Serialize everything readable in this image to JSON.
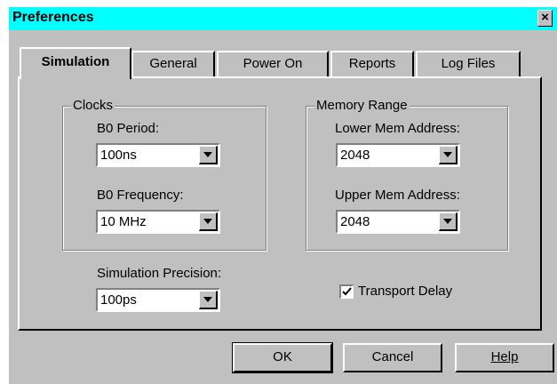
{
  "window": {
    "title": "Preferences",
    "close_label": "×"
  },
  "tabs": [
    {
      "label": "Simulation",
      "active": true
    },
    {
      "label": "General",
      "active": false
    },
    {
      "label": "Power On",
      "active": false
    },
    {
      "label": "Reports",
      "active": false
    },
    {
      "label": "Log Files",
      "active": false
    }
  ],
  "clocks": {
    "group_label": "Clocks",
    "period_label": "B0 Period:",
    "period_value": "100ns",
    "frequency_label": "B0 Frequency:",
    "frequency_value": "10 MHz"
  },
  "memory": {
    "group_label": "Memory Range",
    "lower_label": "Lower Mem Address:",
    "lower_value": "2048",
    "upper_label": "Upper Mem Address:",
    "upper_value": "2048"
  },
  "precision": {
    "label": "Simulation Precision:",
    "value": "100ps"
  },
  "transport_delay": {
    "label": "Transport Delay",
    "checked": true
  },
  "buttons": {
    "ok": "OK",
    "cancel": "Cancel",
    "help": "Help"
  },
  "colors": {
    "titlebar": "#00ffff",
    "face": "#c0c0c0"
  }
}
